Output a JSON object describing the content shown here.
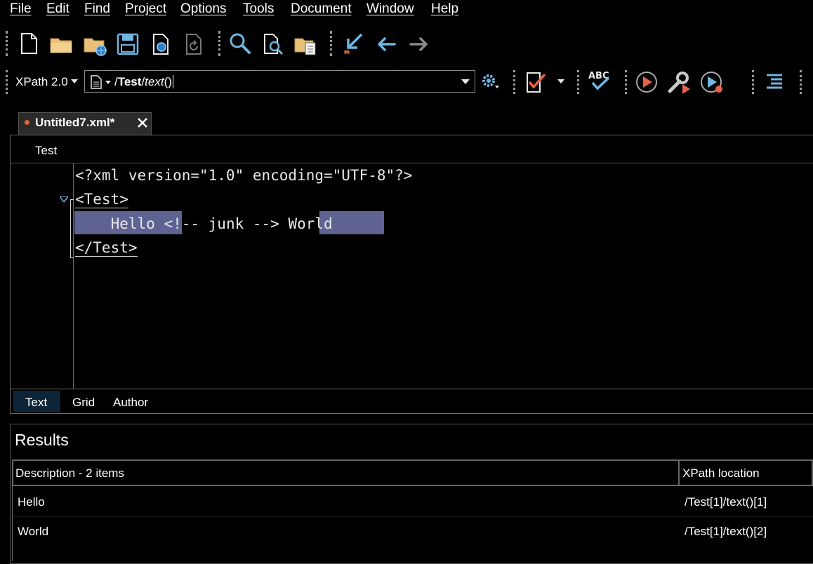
{
  "menu": [
    "File",
    "Edit",
    "Find",
    "Project",
    "Options",
    "Tools",
    "Document",
    "Window",
    "Help"
  ],
  "xpath": {
    "version": "XPath 2.0",
    "expression_prefix": "/",
    "expression_bold": "Test",
    "expression_sep": "/",
    "expression_italic": "text",
    "expression_suffix": "()"
  },
  "tab": {
    "title": "Untitled7.xml*"
  },
  "breadcrumb": "Test",
  "code": {
    "line1": "<?xml version=\"1.0\" encoding=\"UTF-8\"?>",
    "line2": "<Test>",
    "line3_hello": "    Hello ",
    "line3_comment": "<!-- junk --> ",
    "line3_world": "World",
    "line4": "</Test>"
  },
  "modes": [
    "Text",
    "Grid",
    "Author"
  ],
  "results": {
    "title": "Results",
    "headers": [
      "Description - 2 items",
      "XPath location"
    ],
    "rows": [
      [
        "Hello",
        "/Test[1]/text()[1]"
      ],
      [
        "World",
        "/Test[1]/text()[2]"
      ]
    ]
  },
  "colors": {
    "highlight": "#5f6391",
    "accent": "#6fb6e0",
    "run": "#e8634a"
  }
}
